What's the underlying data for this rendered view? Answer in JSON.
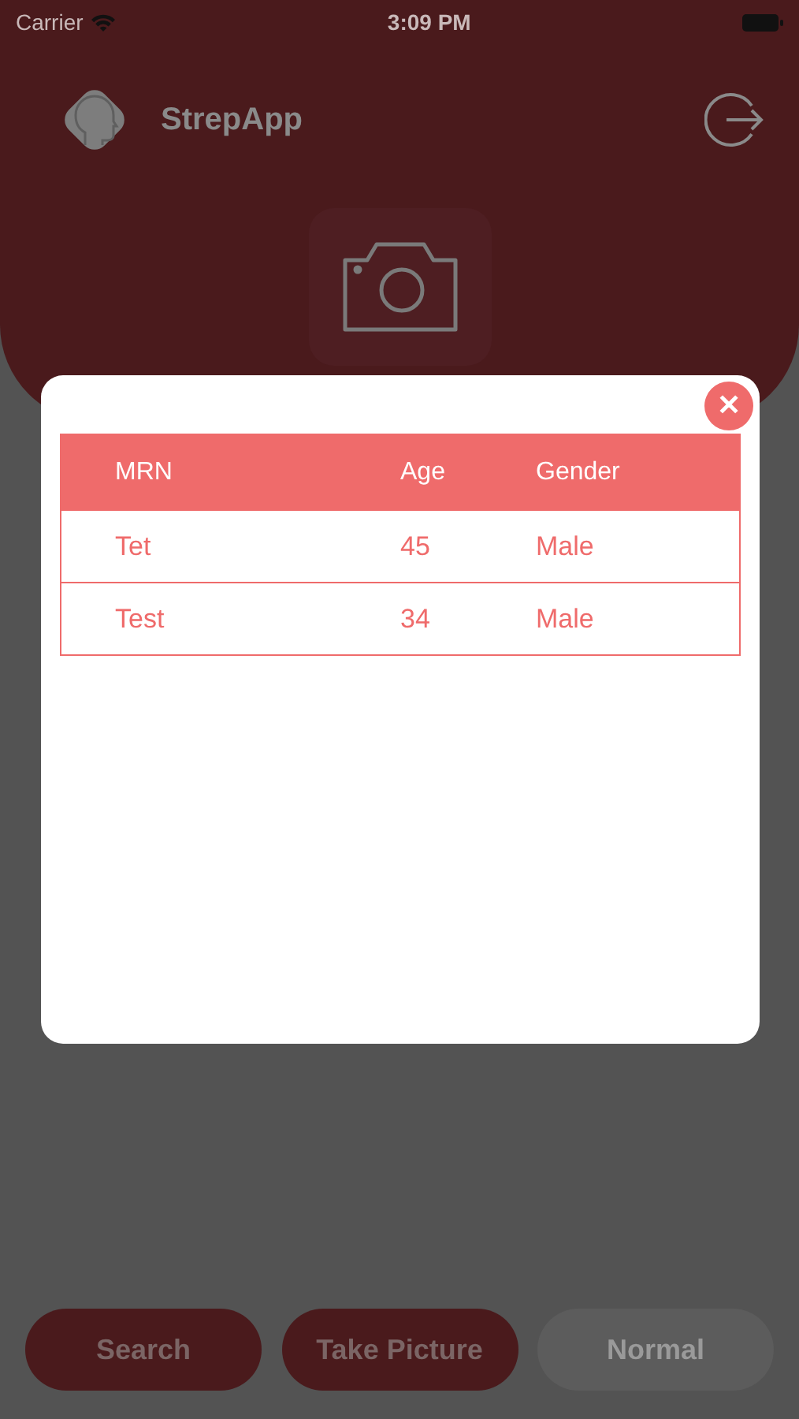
{
  "status_bar": {
    "carrier": "Carrier",
    "time": "3:09 PM"
  },
  "header": {
    "app_name": "StrepApp"
  },
  "buttons": [
    {
      "label": "Search",
      "disabled": false
    },
    {
      "label": "Take Picture",
      "disabled": false
    },
    {
      "label": "Normal",
      "disabled": true
    }
  ],
  "dialog": {
    "close": "✕",
    "table": {
      "columns": [
        "MRN",
        "Age",
        "Gender"
      ],
      "rows": [
        [
          "Tet",
          "45",
          "Male"
        ],
        [
          "Test",
          "34",
          "Male"
        ]
      ]
    }
  }
}
